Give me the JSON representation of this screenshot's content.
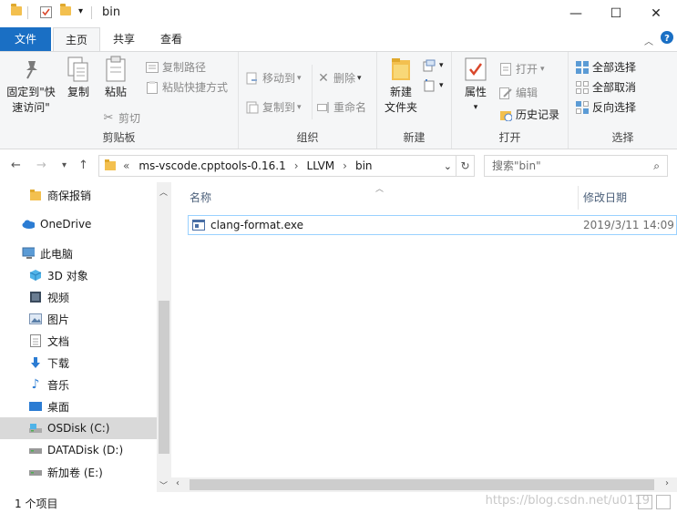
{
  "window": {
    "title": "bin",
    "minimize": "—",
    "maximize": "☐",
    "close": "✕"
  },
  "tabs": {
    "file": "文件",
    "home": "主页",
    "share": "共享",
    "view": "查看"
  },
  "ribbon": {
    "clipboard": {
      "label": "剪贴板",
      "pin": "固定到\"快速访问\"",
      "copy": "复制",
      "paste": "粘贴",
      "copy_path": "复制路径",
      "paste_shortcut": "粘贴快捷方式",
      "cut": "剪切"
    },
    "organize": {
      "label": "组织",
      "move_to": "移动到",
      "copy_to": "复制到",
      "delete": "删除",
      "rename": "重命名"
    },
    "new": {
      "label": "新建",
      "new_folder": "新建\n文件夹"
    },
    "open": {
      "label": "打开",
      "properties": "属性",
      "open": "打开",
      "edit": "编辑",
      "history": "历史记录"
    },
    "select": {
      "label": "选择",
      "select_all": "全部选择",
      "select_none": "全部取消",
      "invert": "反向选择"
    }
  },
  "address": {
    "overflow": "«",
    "crumbs": [
      "ms-vscode.cpptools-0.16.1",
      "LLVM",
      "bin"
    ],
    "search_placeholder": "搜索\"bin\""
  },
  "nav": {
    "items": [
      {
        "label": "商保报销",
        "icon": "folder-icon"
      },
      {
        "label": "OneDrive",
        "icon": "cloud-icon"
      },
      {
        "label": "此电脑",
        "icon": "computer-icon"
      },
      {
        "label": "3D 对象",
        "icon": "3d-objects-icon"
      },
      {
        "label": "视频",
        "icon": "video-icon"
      },
      {
        "label": "图片",
        "icon": "picture-icon"
      },
      {
        "label": "文档",
        "icon": "document-icon"
      },
      {
        "label": "下载",
        "icon": "download-icon"
      },
      {
        "label": "音乐",
        "icon": "music-icon"
      },
      {
        "label": "桌面",
        "icon": "desktop-icon"
      },
      {
        "label": "OSDisk (C:)",
        "icon": "drive-icon"
      },
      {
        "label": "DATADisk (D:)",
        "icon": "drive-icon"
      },
      {
        "label": "新加卷 (E:)",
        "icon": "drive-icon"
      }
    ]
  },
  "columns": {
    "name": "名称",
    "modified": "修改日期"
  },
  "files": [
    {
      "name": "clang-format.exe",
      "modified": "2019/3/11 14:09"
    }
  ],
  "status": {
    "count": "1 个项目",
    "watermark": "https://blog.csdn.net/u0119"
  }
}
